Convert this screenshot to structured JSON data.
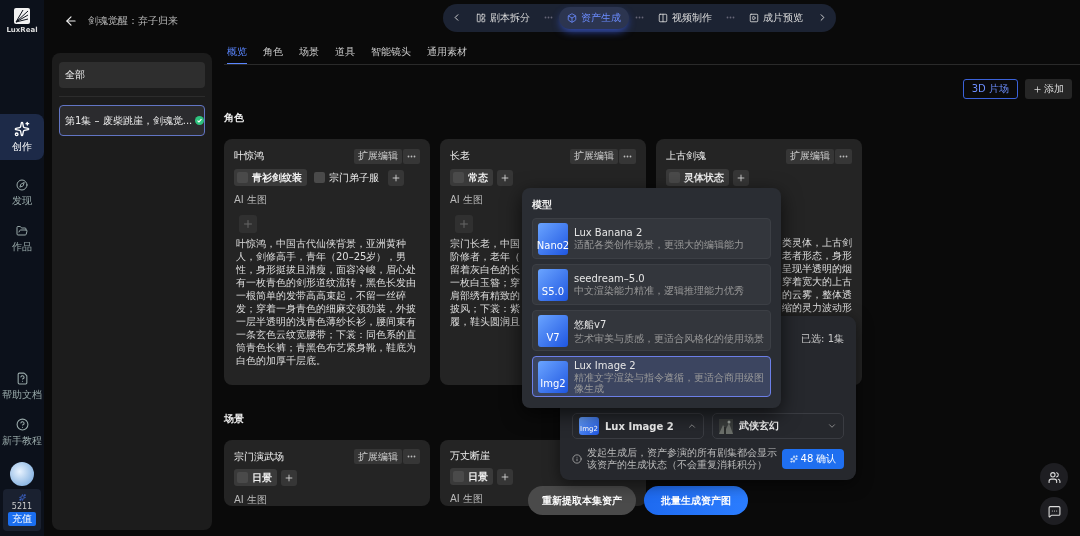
{
  "rail": {
    "logo_text": "LuxReal",
    "items": [
      {
        "label": "创作",
        "selected": true
      },
      {
        "label": "发现",
        "selected": false
      },
      {
        "label": "作品",
        "selected": false
      }
    ],
    "bottom_items": [
      "帮助文档",
      "新手教程"
    ],
    "credits": "5211",
    "recharge": "充值"
  },
  "header": {
    "title": "剑魂觉醒：弃子归来"
  },
  "steps": [
    {
      "label": "剧本拆分",
      "selected": false
    },
    {
      "label": "资产生成",
      "selected": true
    },
    {
      "label": "视频制作",
      "selected": false
    },
    {
      "label": "成片预览",
      "selected": false
    }
  ],
  "episodes": [
    {
      "label": "全部",
      "selected": false,
      "done": false
    },
    {
      "label": "第1集 – 废柴跳崖，剑魂觉...",
      "selected": true,
      "done": true
    }
  ],
  "tabs": [
    {
      "label": "概览",
      "selected": true
    },
    {
      "label": "角色",
      "selected": false
    },
    {
      "label": "场景",
      "selected": false
    },
    {
      "label": "道具",
      "selected": false
    },
    {
      "label": "智能镜头",
      "selected": false
    },
    {
      "label": "通用素材",
      "selected": false
    }
  ],
  "toolbar": {
    "stage_button": "3D 片场",
    "add_button": "添加"
  },
  "sections": [
    {
      "title": "角色",
      "cards": [
        {
          "name": "叶惊鸿",
          "edit": "扩展编辑",
          "tags": [
            {
              "label": "青衫剑纹装",
              "selected": true
            },
            {
              "label": "宗门弟子服",
              "selected": false
            }
          ],
          "ai_label": "AI 生图",
          "description": "叶惊鸿，中国古代仙侠背景，亚洲黄种人，剑修高手，青年（20–25岁），男性，身形挺拔且清瘦，面容冷峻，眉心处有一枚青色的剑形道纹流转，黑色长发由一根简单的发带高高束起，不留一丝碎发；穿着一身青色的细麻交领劲装，外披一层半透明的浅青色薄纱长衫，腰间束有一条玄色云纹宽腰带；下裳：同色系的直筒青色长裤；青黑色布艺紧身靴，鞋底为白色的加厚千层底。"
        },
        {
          "name": "长老",
          "edit": "扩展编辑",
          "tags": [
            {
              "label": "常态",
              "selected": true
            }
          ],
          "ai_label": "AI 生图",
          "fragments": [
            "宗门长老，中国",
            "阶修者，老年（",
            "留着灰白色的长",
            "一枚白玉簪；穿",
            "肩部绣有精致的",
            "披风；下裳：紫",
            "履，鞋头圆润且"
          ]
        },
        {
          "name": "上古剑魂",
          "edit": "扩展编辑",
          "tags": [
            {
              "label": "灵体状态",
              "selected": true
            }
          ],
          "fragments": [
            "类灵体，上古剑",
            "老者形态，身形",
            "呈现半透明的烟",
            "穿着宽大的上古",
            "的云雾，整体透",
            "缩的灵力波动形"
          ]
        }
      ]
    },
    {
      "title": "场景",
      "cards": [
        {
          "name": "宗门演武场",
          "edit": "扩展编辑",
          "tags": [
            {
              "label": "日景",
              "selected": true
            }
          ],
          "ai_label": "AI 生图"
        },
        {
          "name": "万丈断崖",
          "tags": [
            {
              "label": "日景",
              "selected": true
            }
          ],
          "ai_label": "AI 生图"
        }
      ]
    }
  ],
  "model_menu": {
    "title": "模型",
    "items": [
      {
        "badge": "Nano2",
        "name": "Lux Banana 2",
        "description": "适配各类创作场景，更强大的编辑能力",
        "selected": false
      },
      {
        "badge": "S5.0",
        "name": "seedream–5.0",
        "description": "中文渲染能力精准，逻辑推理能力优秀",
        "selected": false
      },
      {
        "badge": "V7",
        "name": "悠船v7",
        "description": "艺术审美与质感，更适合风格化的使用场景",
        "selected": false
      },
      {
        "badge": "Img2",
        "name": "Lux Image 2",
        "description": "精准文字渲染与指令遵循，更适合商用级图像生成",
        "selected": true
      }
    ]
  },
  "generate_panel": {
    "selected_count": "已选: 1集",
    "model_badge": "Img2",
    "model": "Lux Image 2",
    "style": "武侠玄幻",
    "note": "发起生成后，资产参演的所有剧集都会显示该资产的生成状态（不会重复消耗积分）",
    "confirm": "48 确认"
  },
  "actions": {
    "re_extract": "重新提取本集资产",
    "batch": "批量生成资产图"
  }
}
